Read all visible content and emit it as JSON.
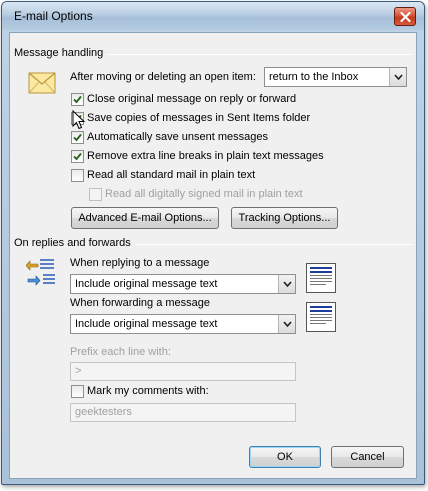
{
  "window": {
    "title": "E-mail Options"
  },
  "message_handling": {
    "label": "Message handling",
    "after_move_label": "After moving or deleting an open item:",
    "after_move_value": "return to the Inbox",
    "options": [
      {
        "label": "Close original message on reply or forward",
        "checked": true
      },
      {
        "label": "Save copies of messages in Sent Items folder",
        "checked": true
      },
      {
        "label": "Automatically save unsent messages",
        "checked": true
      },
      {
        "label": "Remove extra line breaks in plain text messages",
        "checked": true
      },
      {
        "label": "Read all standard mail in plain text",
        "checked": false
      },
      {
        "label": "Read all digitally signed mail in plain text",
        "checked": false
      }
    ],
    "advanced_button": "Advanced E-mail Options...",
    "tracking_button": "Tracking Options..."
  },
  "replies": {
    "label": "On replies and forwards",
    "reply_label": "When replying to a message",
    "reply_value": "Include original message text",
    "forward_label": "When forwarding a message",
    "forward_value": "Include original message text",
    "prefix_label": "Prefix each line with:",
    "prefix_value": ">",
    "mark_label": "Mark my comments with:",
    "mark_value": "geektesters"
  },
  "buttons": {
    "ok": "OK",
    "cancel": "Cancel"
  },
  "colors": {
    "check": "#2a5e1e",
    "accent": "#1e3c9a"
  }
}
